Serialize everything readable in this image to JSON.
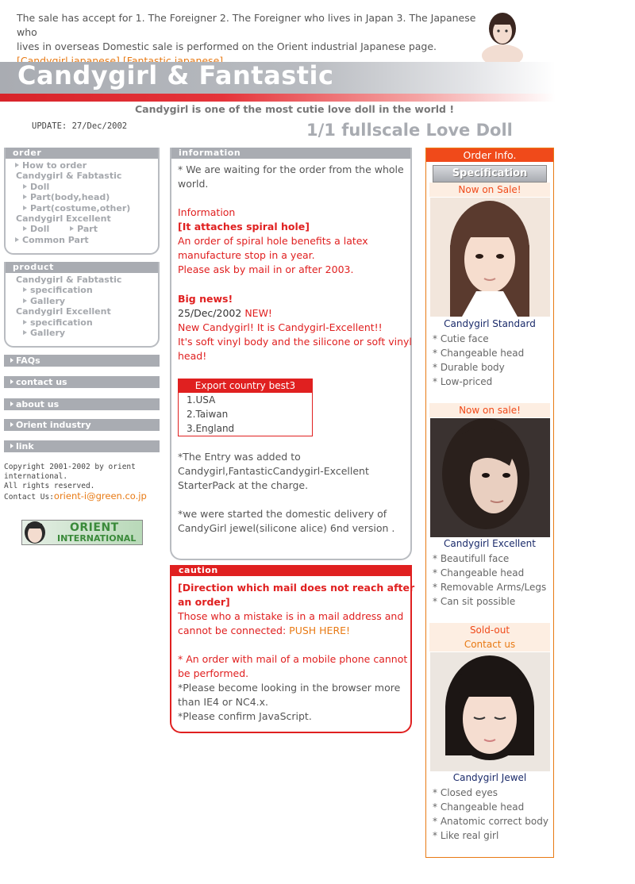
{
  "notice": {
    "text_line1": "The sale has accept for 1. The Foreigner 2. The Foreigner who lives in Japan 3. The Japanese who",
    "text_line2": "lives in overseas Domestic sale is performed on the Orient industrial Japanese page.",
    "link_candygirl": "[Candygirl japanese]",
    "link_fantastic": "[Fantastic japanese]"
  },
  "banner": {
    "title": "Candygirl & Fantastic",
    "tagline": "Candygirl is one of the most cutie love doll in the world !",
    "update": "UPDATE: 27/Dec/2002",
    "fullscale": "1/1 fullscale Love Doll"
  },
  "menu_order": {
    "heading": "order",
    "items": [
      "How to order",
      "Candygirl & Fabtastic",
      "Doll",
      "Part(body,head)",
      "Part(costume,other)",
      "Candygirl Excellent",
      "Doll",
      "Part",
      "Common Part"
    ]
  },
  "menu_product": {
    "heading": "product",
    "items": [
      "Candygirl & Fabtastic",
      "specification",
      "Gallery",
      "Candygirl Excellent",
      "specification",
      "Gallery"
    ]
  },
  "nav": {
    "faqs": "FAQs",
    "contact": "contact us",
    "about": "about us",
    "orient": "Orient industry",
    "link": "link"
  },
  "footer": {
    "copyright1": "Copyright 2001-2002 by orient",
    "copyright2": "international.",
    "copyright3": "All rights reserved.",
    "contact_label": "Contact Us:",
    "email": "orient-i@green.co.jp",
    "logo_line1": "ORIENT",
    "logo_line2": "INTERNATIONAL"
  },
  "information": {
    "heading": "information",
    "waiting1": "* We are waiting for the order from the whole",
    "waiting2": "world.",
    "info_label": "Information",
    "spiral_title": "[It attaches spiral hole]",
    "spiral_1": "An order of spiral hole benefits a latex",
    "spiral_2": "manufacture stop in a year.",
    "spiral_3": "Please ask by mail in or after 2003.",
    "bignews": "Big news!",
    "date": "25/Dec/2002",
    "new_tag": "NEW!",
    "news_1": "New Candygirl! It is Candygirl-Excellent!!",
    "news_2": "It's soft vinyl body and the silicone or soft vinyl",
    "news_3": "head!",
    "export_heading": "Export country best3",
    "export_list": [
      "1.USA",
      "2.Taiwan",
      "3.England"
    ],
    "entry_1": "*The Entry was added to",
    "entry_2": "Candygirl,FantasticCandygirl-Excellent",
    "entry_3": "StarterPack at the charge.",
    "domestic_1": "*we were started the domestic delivery of",
    "domestic_2": "CandyGirl jewel(silicone alice) 6nd version ."
  },
  "caution": {
    "heading": "caution",
    "title_1": "[Direction which mail does not reach after",
    "title_2": "an order]",
    "mistake_1": "Those who a mistake is in a mail address and",
    "mistake_2": "cannot be connected:",
    "push_here": "PUSH HERE!",
    "mobile_1": "* An order with mail of a mobile phone cannot",
    "mobile_2": "be performed.",
    "browser_1": "*Please become looking in the browser more",
    "browser_2": "than IE4 or NC4.x.",
    "js": "*Please confirm JavaScript."
  },
  "order_info": {
    "heading": "Order Info.",
    "spec_button": "Specification",
    "products": [
      {
        "status": "Now on Sale!",
        "name": "Candygirl Standard",
        "features": [
          "* Cutie face",
          "* Changeable head",
          "* Durable body",
          "* Low-priced"
        ]
      },
      {
        "status": "Now on sale!",
        "name": "Candygirl Excellent",
        "features": [
          "* Beautifull face",
          "* Changeable head",
          "* Removable Arms/Legs",
          "* Can sit possible"
        ]
      },
      {
        "status": "Sold-out",
        "contact": "Contact us",
        "name": "Candygirl Jewel",
        "features": [
          "* Closed eyes",
          "* Changeable head",
          "* Anatomic correct body",
          "* Like real girl"
        ]
      }
    ]
  },
  "colors": {
    "banner_gray": "#a9acb2",
    "accent_red": "#e02020",
    "link_orange": "#e87a14",
    "product_name_navy": "#1a2a6a"
  }
}
